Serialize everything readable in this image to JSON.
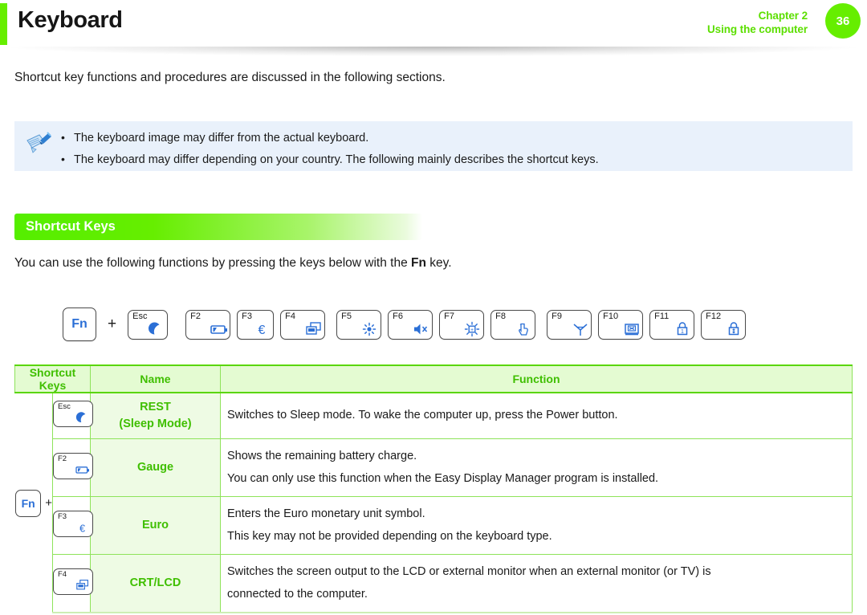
{
  "header": {
    "title": "Keyboard",
    "chapter": "Chapter 2",
    "chapter_subtitle": "Using the computer",
    "page_number": "36",
    "accent_color": "#66ee00",
    "title_color": "#161616"
  },
  "intro": {
    "text": "Shortcut key functions and procedures are discussed in the following sections."
  },
  "note": {
    "icon": "note-pencil-icon",
    "background_color": "#e9f1fb",
    "bullet": "•",
    "items": [
      "The keyboard image may differ from the actual keyboard.",
      "The keyboard may differ depending on your country. The following mainly describes the shortcut keys."
    ]
  },
  "section": {
    "heading": "Shortcut Keys",
    "heading_color": "#66ee00",
    "description_pre": "You can use the following functions by pressing the keys below with the ",
    "description_bold": "Fn",
    "description_post": " key."
  },
  "key_diagram": {
    "fn_label": "Fn",
    "plus": "+",
    "keys": [
      {
        "label": "Esc",
        "icon": "moon-icon"
      },
      {
        "label": "F2",
        "icon": "battery-icon"
      },
      {
        "label": "F3",
        "icon": "euro-icon"
      },
      {
        "label": "F4",
        "icon": "dual-monitor-icon"
      },
      {
        "label": "F5",
        "icon": "brightness-down-icon"
      },
      {
        "label": "F6",
        "icon": "mute-speaker-icon"
      },
      {
        "label": "F7",
        "icon": "brightness-up-icon"
      },
      {
        "label": "F8",
        "icon": "hand-touch-icon"
      },
      {
        "label": "F9",
        "icon": "wireless-antenna-icon"
      },
      {
        "label": "F10",
        "icon": "touchpad-off-icon"
      },
      {
        "label": "F11",
        "icon": "num-lock-icon"
      },
      {
        "label": "F12",
        "icon": "scroll-lock-icon"
      }
    ]
  },
  "table": {
    "columns": [
      "Shortcut Keys",
      "Name",
      "Function"
    ],
    "fn_label": "Fn",
    "fn_plus": "+",
    "rows": [
      {
        "key_label": "Esc",
        "key_icon": "moon-icon",
        "name_line1": "REST",
        "name_line2": "(Sleep Mode)",
        "function_lines": [
          "Switches to Sleep mode. To wake the computer up, press the Power button."
        ]
      },
      {
        "key_label": "F2",
        "key_icon": "battery-icon",
        "name_line1": "Gauge",
        "name_line2": "",
        "function_lines": [
          "Shows the remaining battery charge.",
          "You can only use this function when the Easy Display Manager program is installed."
        ]
      },
      {
        "key_label": "F3",
        "key_icon": "euro-icon",
        "name_line1": "Euro",
        "name_line2": "",
        "function_lines": [
          "Enters the Euro monetary unit symbol.",
          "This key may not be provided depending on the keyboard type."
        ]
      },
      {
        "key_label": "F4",
        "key_icon": "dual-monitor-icon",
        "name_line1": "CRT/LCD",
        "name_line2": "",
        "function_lines": [
          "Switches the screen output to the LCD or external monitor when an external monitor (or TV) is",
          "connected to the computer."
        ]
      }
    ]
  }
}
